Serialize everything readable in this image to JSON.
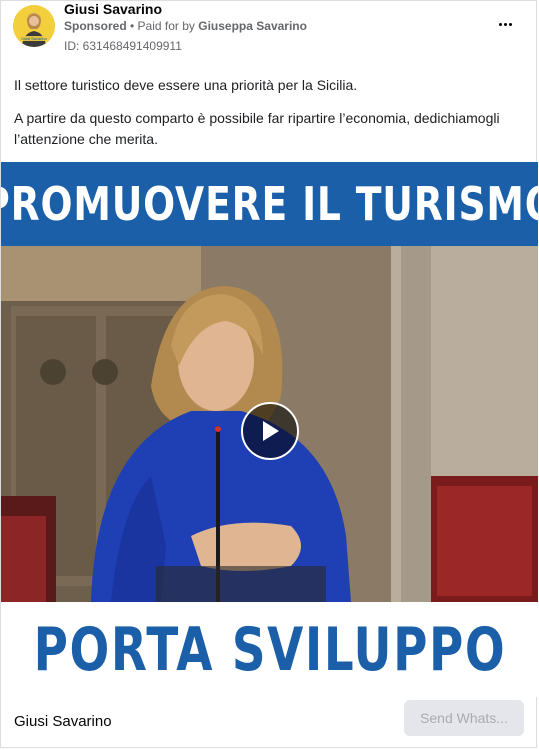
{
  "header": {
    "advertiser": "Giusi Savarino",
    "sponsored": "Sponsored",
    "separator": " • ",
    "paid_for_by": "Paid for by ",
    "payer": "Giuseppa Savarino",
    "ad_id": "ID: 631468491409911",
    "avatar_logo_text": "Giusi Savarino"
  },
  "body": {
    "paragraph_1": "Il settore turistico deve essere una priorità per la Sicilia.",
    "paragraph_2": "A partire da questo comparto è possibile far ripartire l’economia, dedichiamogli l’attenzione che merita."
  },
  "media": {
    "top_banner": "PROMUOVERE IL TURISMO",
    "bottom_banner": "PORTA SVILUPPO",
    "play_icon": "play-icon"
  },
  "footer": {
    "page_name": "Giusi Savarino",
    "cta_label": "Send Whats..."
  },
  "colors": {
    "banner_blue": "#1c5fa9",
    "cta_bg": "#e4e6eb",
    "cta_text": "#a8abaf"
  }
}
